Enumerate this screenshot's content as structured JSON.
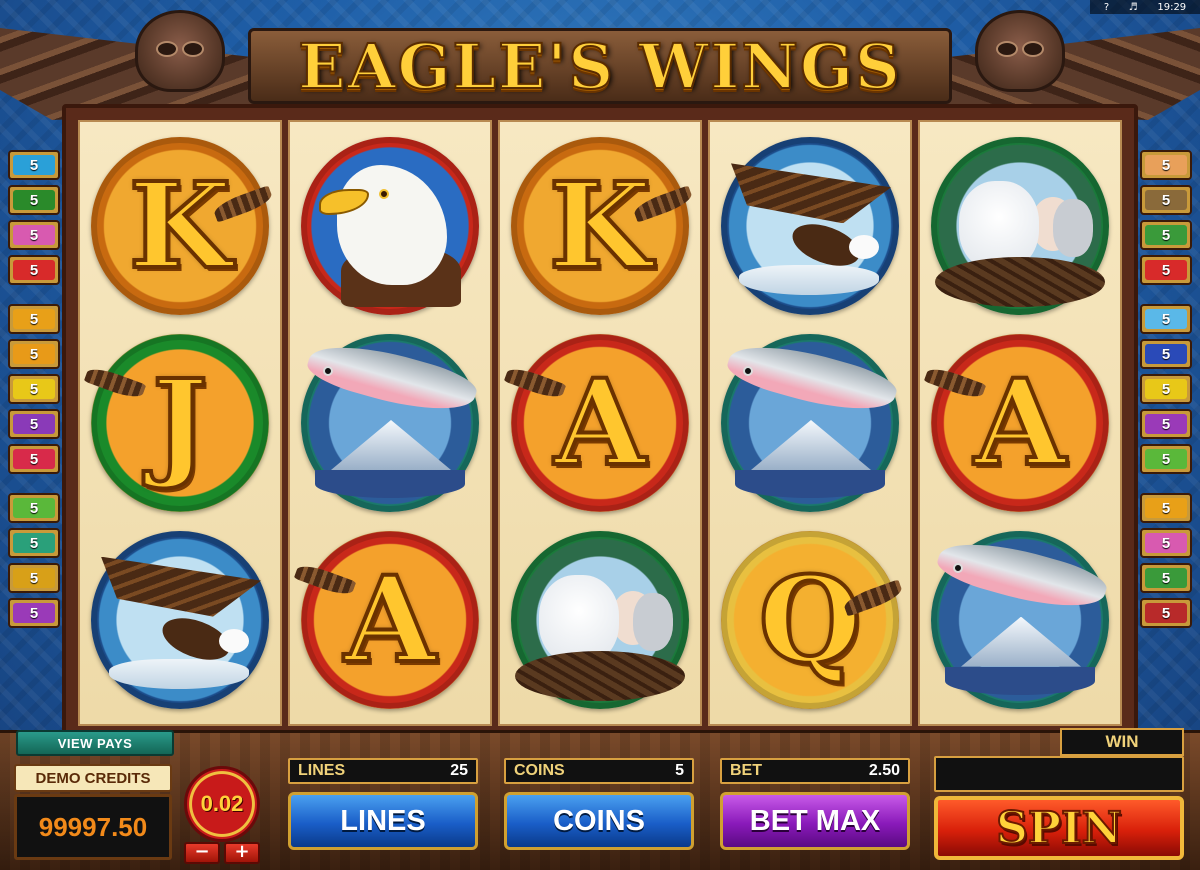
{
  "system": {
    "help": "?",
    "time": "19:29"
  },
  "title": "EAGLE'S WINGS",
  "reels": [
    [
      {
        "kind": "letter",
        "glyph": "K",
        "name": "symbol-k",
        "feather": "r"
      },
      {
        "kind": "letter",
        "glyph": "J",
        "name": "symbol-j",
        "feather": "l"
      },
      {
        "kind": "pic",
        "pic": "flying-eagle",
        "name": "symbol-flying-eagle"
      }
    ],
    [
      {
        "kind": "pic",
        "pic": "eagle-head",
        "name": "symbol-eagle-head"
      },
      {
        "kind": "pic",
        "pic": "fish",
        "name": "symbol-salmon"
      },
      {
        "kind": "letter",
        "glyph": "A",
        "name": "symbol-a",
        "feather": "l"
      }
    ],
    [
      {
        "kind": "letter",
        "glyph": "K",
        "name": "symbol-k",
        "feather": "r"
      },
      {
        "kind": "letter",
        "glyph": "A",
        "name": "symbol-a",
        "feather": "l"
      },
      {
        "kind": "pic",
        "pic": "chicks",
        "name": "symbol-eaglet-nest"
      }
    ],
    [
      {
        "kind": "pic",
        "pic": "flying-eagle",
        "name": "symbol-flying-eagle"
      },
      {
        "kind": "pic",
        "pic": "fish",
        "name": "symbol-salmon"
      },
      {
        "kind": "letter",
        "glyph": "Q",
        "name": "symbol-q",
        "feather": "r"
      }
    ],
    [
      {
        "kind": "pic",
        "pic": "chicks",
        "name": "symbol-eaglet-nest"
      },
      {
        "kind": "letter",
        "glyph": "A",
        "name": "symbol-a",
        "feather": "l"
      },
      {
        "kind": "pic",
        "pic": "fish",
        "name": "symbol-salmon"
      }
    ]
  ],
  "markers_left": [
    [
      {
        "label": "5",
        "color": "#2aa0d8"
      },
      {
        "label": "5",
        "color": "#2a8a2a"
      },
      {
        "label": "5",
        "color": "#d85ab0"
      },
      {
        "label": "5",
        "color": "#d82a2a"
      }
    ],
    [
      {
        "label": "5",
        "color": "#e8a018"
      },
      {
        "label": "5",
        "color": "#e89a18"
      },
      {
        "label": "5",
        "color": "#e8c818"
      },
      {
        "label": "5",
        "color": "#8a3ab8"
      },
      {
        "label": "5",
        "color": "#d82a4a"
      }
    ],
    [
      {
        "label": "5",
        "color": "#5ab83a"
      },
      {
        "label": "5",
        "color": "#2aa07a"
      },
      {
        "label": "5",
        "color": "#d8a018"
      },
      {
        "label": "5",
        "color": "#9a3ab8"
      }
    ]
  ],
  "markers_right": [
    [
      {
        "label": "5",
        "color": "#e8a05a"
      },
      {
        "label": "5",
        "color": "#8a6a3a"
      },
      {
        "label": "5",
        "color": "#3a9a3a"
      },
      {
        "label": "5",
        "color": "#d82a2a"
      }
    ],
    [
      {
        "label": "5",
        "color": "#5ab8e8"
      },
      {
        "label": "5",
        "color": "#2a4ab8"
      },
      {
        "label": "5",
        "color": "#e8c818"
      },
      {
        "label": "5",
        "color": "#9a3ab8"
      },
      {
        "label": "5",
        "color": "#5ab83a"
      }
    ],
    [
      {
        "label": "5",
        "color": "#e8a018"
      },
      {
        "label": "5",
        "color": "#d85ab0"
      },
      {
        "label": "5",
        "color": "#3a9a3a"
      },
      {
        "label": "5",
        "color": "#b82a2a"
      }
    ]
  ],
  "controls": {
    "view_pays": "VIEW PAYS",
    "credits_label": "DEMO CREDITS",
    "credits_value": "99997.50",
    "coin_value": "0.02",
    "minus": "−",
    "plus": "+",
    "lines_label": "LINES",
    "lines_value": "25",
    "coins_label": "COINS",
    "coins_value": "5",
    "bet_label": "BET",
    "bet_value": "2.50",
    "lines_button": "LINES",
    "coins_button": "COINS",
    "betmax_button": "BET MAX",
    "win_label": "WIN",
    "win_value": "",
    "spin_button": "SPIN"
  }
}
